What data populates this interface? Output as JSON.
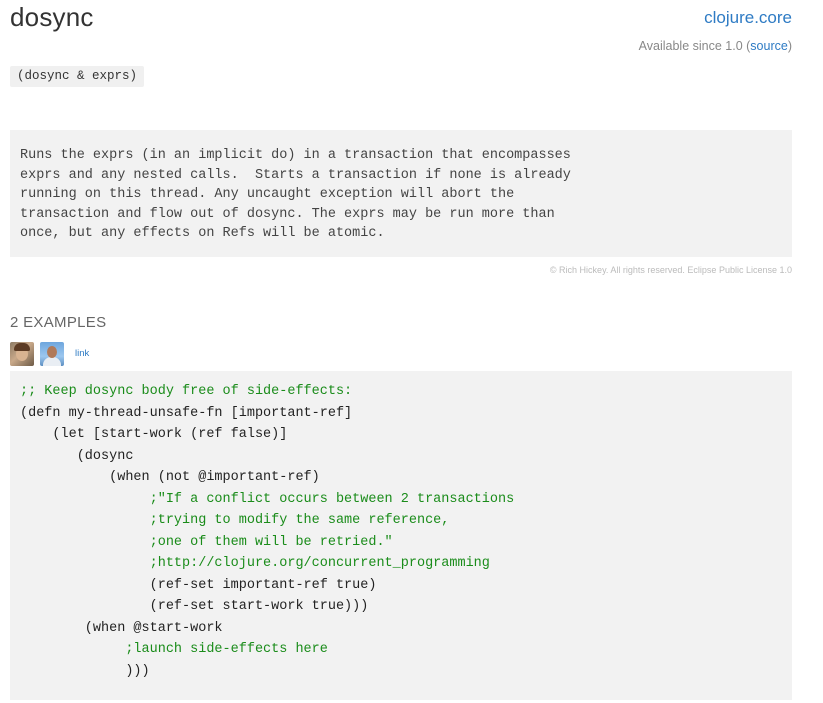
{
  "header": {
    "title": "dosync",
    "namespace": "clojure.core",
    "since_prefix": "Available since 1.0 (",
    "source_label": "source",
    "since_suffix": ")"
  },
  "signature": "(dosync & exprs)",
  "docstring": "Runs the exprs (in an implicit do) in a transaction that encompasses\nexprs and any nested calls.  Starts a transaction if none is already\nrunning on this thread. Any uncaught exception will abort the\ntransaction and flow out of dosync. The exprs may be run more than\nonce, but any effects on Refs will be atomic.",
  "copyright": "© Rich Hickey. All rights reserved. Eclipse Public License 1.0",
  "examples": {
    "title": "2 EXAMPLES",
    "link_label": "link",
    "avatars": [
      "avatar-user-1",
      "avatar-user-2"
    ],
    "code_lines": [
      ";; Keep dosync body free of side-effects:",
      "(defn my-thread-unsafe-fn [important-ref]",
      "    (let [start-work (ref false)]",
      "       (dosync",
      "           (when (not @important-ref)",
      "                ;\"If a conflict occurs between 2 transactions",
      "                ;trying to modify the same reference,",
      "                ;one of them will be retried.\"",
      "                ;http://clojure.org/concurrent_programming",
      "                (ref-set important-ref true)",
      "                (ref-set start-work true)))",
      "        (when @start-work",
      "             ;launch side-effects here",
      "             )))"
    ]
  },
  "colors": {
    "link": "#2e7bc4",
    "comment": "#1a8c1a",
    "keyword": "#4a4aa8",
    "box_background": "#f2f2f2"
  }
}
